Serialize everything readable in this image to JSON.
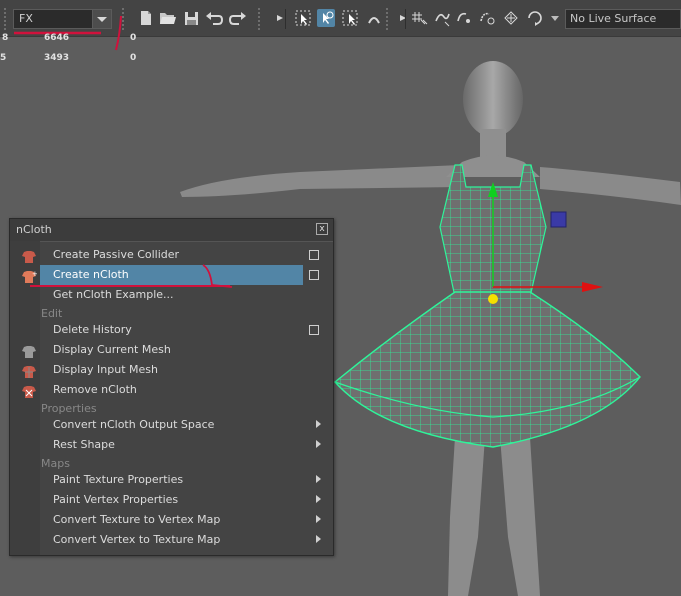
{
  "toolbar": {
    "mode_value": "FX",
    "live_surface": "No Live Surface"
  },
  "stats": {
    "row1": {
      "a": "6646",
      "b": "0"
    },
    "row2": {
      "a": "3493",
      "b": "0"
    }
  },
  "panel": {
    "title": "nCloth",
    "close": "x",
    "items": [
      {
        "label": "Create Passive Collider"
      },
      {
        "label": "Create nCloth"
      },
      {
        "label": "Get nCloth Example..."
      },
      {
        "label": "Delete History"
      },
      {
        "label": "Display Current Mesh"
      },
      {
        "label": "Display Input Mesh"
      },
      {
        "label": "Remove nCloth"
      },
      {
        "label": "Convert nCloth Output Space"
      },
      {
        "label": "Rest Shape"
      },
      {
        "label": "Paint Texture Properties"
      },
      {
        "label": "Paint Vertex Properties"
      },
      {
        "label": "Convert Texture to Vertex Map"
      },
      {
        "label": "Convert Vertex to Texture Map"
      }
    ],
    "sections": {
      "edit": "Edit",
      "properties": "Properties",
      "maps": "Maps"
    }
  },
  "colors": {
    "highlight": "#5285a6",
    "wireframe": "#2ef59a",
    "annotation": "#d1113c",
    "manip_x": "#e01010",
    "manip_y": "#10d020",
    "manip_z": "#3a3aa6"
  },
  "icons": [
    "new-scene-icon",
    "open-scene-icon",
    "save-scene-icon",
    "undo-icon",
    "redo-icon",
    "select-tool-icon",
    "paint-select-icon",
    "snap-to-grid-icon",
    "snap-to-curve-icon",
    "snap-to-point-icon",
    "snap-to-view-plane-icon",
    "make-live-icon"
  ]
}
